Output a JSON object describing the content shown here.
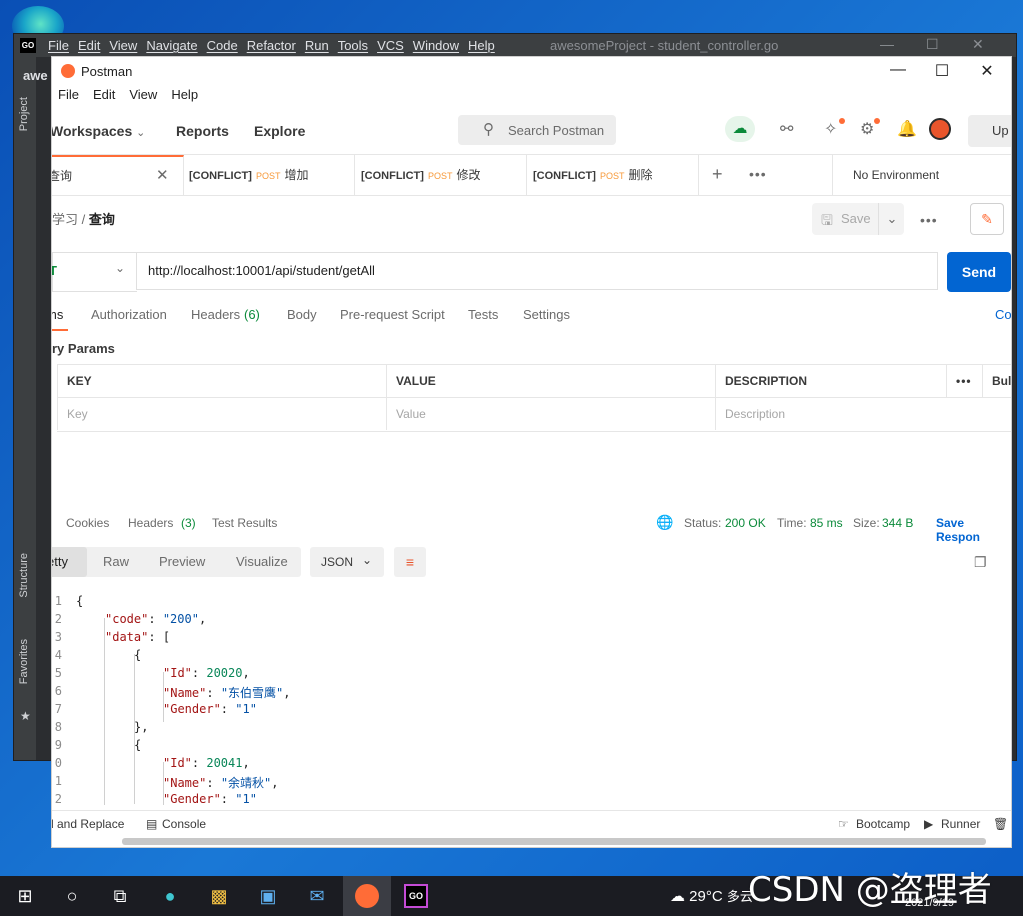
{
  "goland": {
    "logo": "GO",
    "menu": [
      "File",
      "Edit",
      "View",
      "Navigate",
      "Code",
      "Refactor",
      "Run",
      "Tools",
      "VCS",
      "Window",
      "Help"
    ],
    "title": "awesomeProject - student_controller.go",
    "project_tab": "awe",
    "side_labels": {
      "project": "Project",
      "structure": "Structure",
      "favorites": "Favorites"
    }
  },
  "postman": {
    "app_title": "Postman",
    "menu": [
      "File",
      "Edit",
      "View",
      "Help"
    ],
    "nav": {
      "workspaces": "Workspaces",
      "reports": "Reports",
      "explore": "Explore"
    },
    "search_placeholder": "Search Postman",
    "upgrade": "Up",
    "tabs": [
      {
        "name": "查询",
        "active": true
      },
      {
        "conflict": "[CONFLICT]",
        "method": "POST",
        "name": "增加"
      },
      {
        "conflict": "[CONFLICT]",
        "method": "POST",
        "name": "修改"
      },
      {
        "conflict": "[CONFLICT]",
        "method": "POST",
        "name": "删除"
      }
    ],
    "environment": "No Environment",
    "breadcrumb": {
      "parent": "学习",
      "sep": "/",
      "current": "查询"
    },
    "save_label": "Save",
    "request": {
      "method": "T",
      "url": "http://localhost:10001/api/student/getAll",
      "send": "Send"
    },
    "req_tabs": [
      "ms",
      "Authorization",
      "Headers",
      "(6)",
      "Body",
      "Pre-request Script",
      "Tests",
      "Settings",
      "Co"
    ],
    "query_params_title": "ry Params",
    "params_table": {
      "headers": [
        "KEY",
        "VALUE",
        "DESCRIPTION"
      ],
      "bulk": "Bul",
      "placeholders": [
        "Key",
        "Value",
        "Description"
      ]
    },
    "response": {
      "tabs": [
        "Cookies",
        "Headers",
        "(3)",
        "Test Results"
      ],
      "status_label": "Status:",
      "status": "200 OK",
      "time_label": "Time:",
      "time": "85 ms",
      "size_label": "Size:",
      "size": "344 B",
      "save": "Save Respon",
      "views": [
        "etty",
        "Raw",
        "Preview",
        "Visualize"
      ],
      "format": "JSON"
    },
    "body_lines": [
      {
        "ln": "1",
        "text": "{"
      },
      {
        "ln": "2",
        "key": "\"code\"",
        "sep": ": ",
        "str": "\"200\"",
        "end": ","
      },
      {
        "ln": "3",
        "key": "\"data\"",
        "sep": ": ",
        "punct": "["
      },
      {
        "ln": "4",
        "punct": "{"
      },
      {
        "ln": "5",
        "key": "\"Id\"",
        "sep": ": ",
        "num": "20020",
        "end": ","
      },
      {
        "ln": "6",
        "key": "\"Name\"",
        "sep": ": ",
        "str": "\"东伯雪鹰\"",
        "end": ","
      },
      {
        "ln": "7",
        "key": "\"Gender\"",
        "sep": ": ",
        "str": "\"1\""
      },
      {
        "ln": "8",
        "punct": "},"
      },
      {
        "ln": "9",
        "punct": "{"
      },
      {
        "ln": "0",
        "key": "\"Id\"",
        "sep": ": ",
        "num": "20041",
        "end": ","
      },
      {
        "ln": "1",
        "key": "\"Name\"",
        "sep": ": ",
        "str": "\"余靖秋\"",
        "end": ","
      },
      {
        "ln": "2",
        "key": "\"Gender\"",
        "sep": ": ",
        "str": "\"1\""
      }
    ],
    "statusbar": {
      "find": "d and Replace",
      "console": "Console",
      "bootcamp": "Bootcamp",
      "runner": "Runner"
    }
  },
  "taskbar": {
    "weather": "29°C",
    "weather_desc": "多云",
    "date": "2021/9/19"
  },
  "watermark": "CSDN @盗理者"
}
